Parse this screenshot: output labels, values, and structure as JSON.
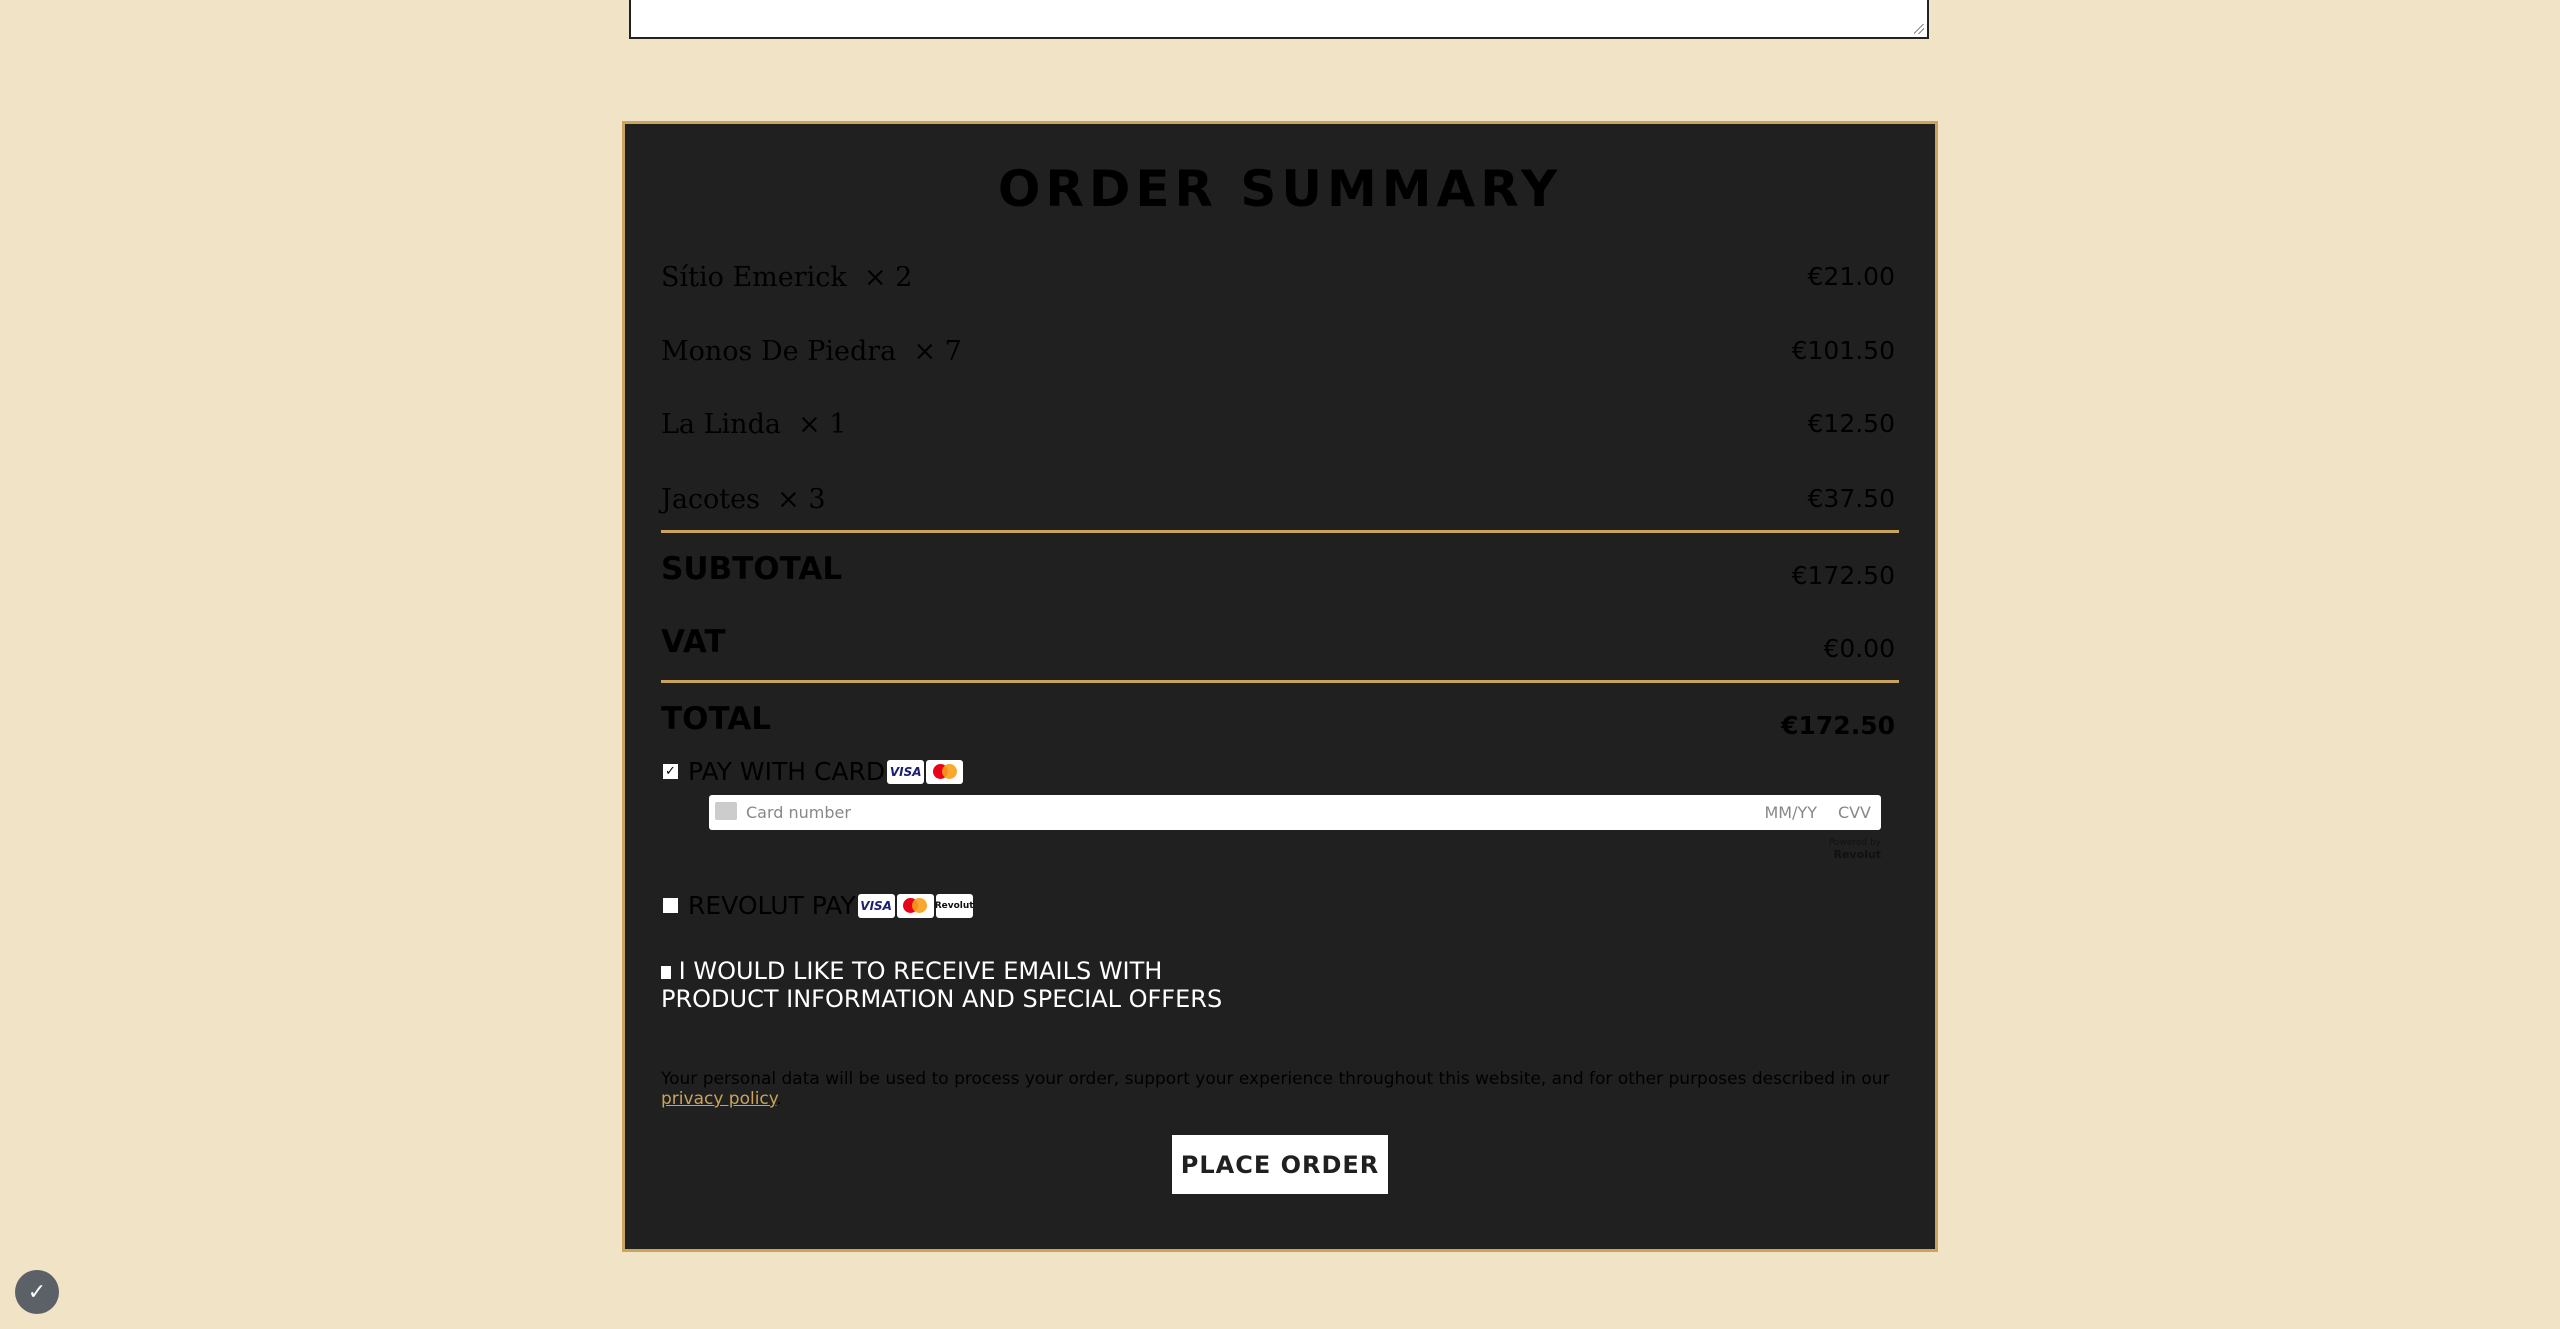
{
  "title": "ORDER SUMMARY",
  "items": [
    {
      "name": "Sítio Emerick",
      "qty": "× 2",
      "price": "€21.00"
    },
    {
      "name": "Monos De Piedra",
      "qty": "× 7",
      "price": "€101.50"
    },
    {
      "name": "La Linda",
      "qty": "× 1",
      "price": "€12.50"
    },
    {
      "name": "Jacotes",
      "qty": "× 3",
      "price": "€37.50"
    }
  ],
  "totals": {
    "subtotal_label": "SUBTOTAL",
    "subtotal": "€172.50",
    "vat_label": "VAT",
    "vat": "€0.00",
    "total_label": "TOTAL",
    "total": "€172.50"
  },
  "payment": {
    "card_label": "PAY WITH CARD",
    "card_checked": true,
    "card_placeholder": "Card number",
    "expiry_placeholder": "MM/YY",
    "cvv_placeholder": "CVV",
    "powered_by": "Powered by",
    "powered_brand": "Revolut",
    "revolut_label": "REVOLUT PAY",
    "revolut_checked": false,
    "visa": "VISA",
    "revolut_badge": "Revolut"
  },
  "newsletter": {
    "line1": "I WOULD LIKE TO RECEIVE EMAILS WITH",
    "line2": "PRODUCT INFORMATION AND SPECIAL OFFERS"
  },
  "privacy": {
    "text": "Your personal data will be used to process your order, support your experience throughout this website, and for other purposes described in our ",
    "link": "privacy policy",
    "end": "."
  },
  "place_order": "PLACE ORDER",
  "colors": {
    "background": "#f1e3c5",
    "panel": "#202020",
    "accent": "#c9a45c"
  },
  "cookie_icon": "cookie-consent-icon"
}
